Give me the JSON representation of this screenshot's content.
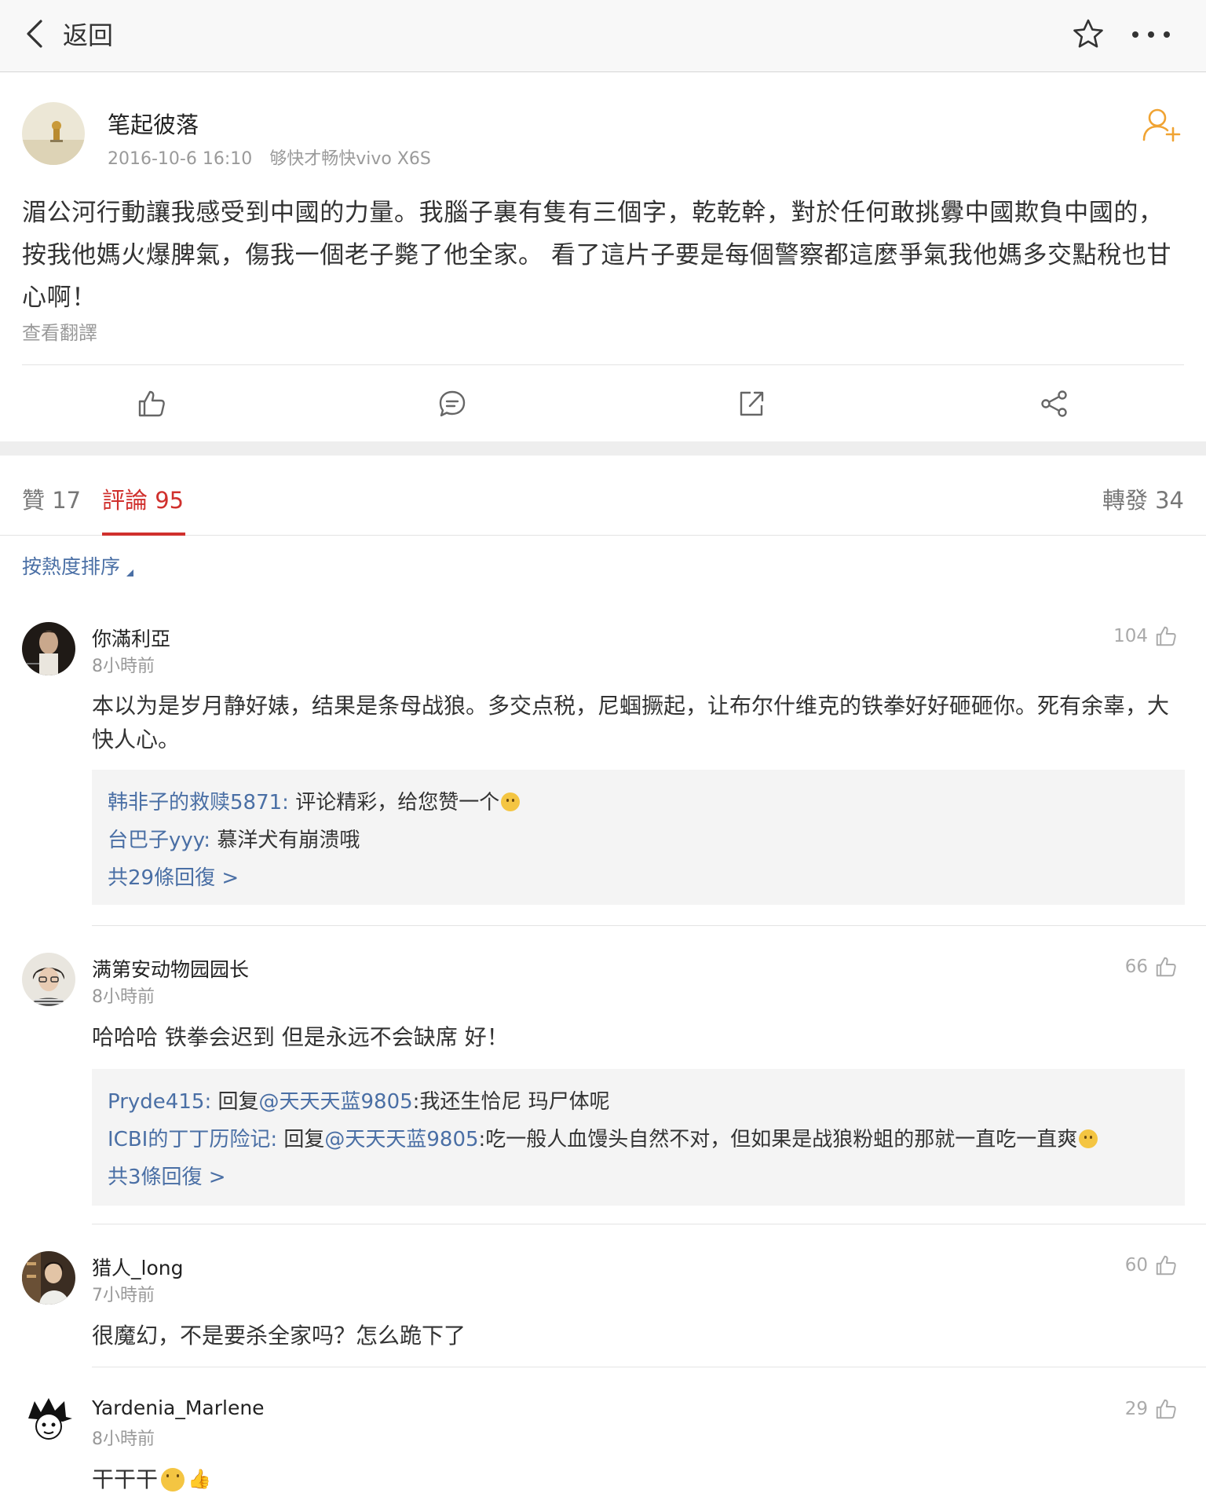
{
  "nav": {
    "back_label": "返回"
  },
  "post": {
    "author": "笔起彼落",
    "date": "2016-10-6 16:10",
    "source": "够快才畅快vivo X6S",
    "text": "湄公河行動讓我感受到中國的力量。我腦子裏有隻有三個字，乾乾幹，對於任何敢挑釁中國欺負中國的，按我他媽火爆脾氣，傷我一個老子斃了他全家。 看了這片子要是每個警察都這麼爭氣我他媽多交點稅也甘心啊！",
    "translate_label": "查看翻譯"
  },
  "tabs": {
    "likes": "贊 17",
    "comments": "評論 95",
    "reposts": "轉發 34"
  },
  "sort_label": "按熱度排序",
  "comments": [
    {
      "name": "你滿利亞",
      "time": "8小時前",
      "likes": "104",
      "text": "本以为是岁月静好婊，结果是条母战狼。多交点税，尼蝈撅起，让布尔什维克的铁拳好好砸砸你。死有余辜，大快人心。",
      "replies": [
        {
          "user": "韩非子的救赎5871",
          "sep": ": ",
          "text": "评论精彩，给您赞一个",
          "mention": "",
          "rest": ""
        },
        {
          "user": "台巴子yyy",
          "sep": ": ",
          "text": "慕洋犬有崩溃哦",
          "mention": "",
          "rest": ""
        }
      ],
      "more": "共29條回復 >"
    },
    {
      "name": "满第安动物园园长",
      "time": "8小時前",
      "likes": "66",
      "text": "哈哈哈 铁拳会迟到 但是永远不会缺席 好！",
      "replies": [
        {
          "user": "Pryde415",
          "sep": ": ",
          "text": "回复",
          "mention": "@天天天蓝9805",
          "rest": ":我还生恰尼 玛尸体呢"
        },
        {
          "user": "ICBI的丁丁历险记",
          "sep": ": ",
          "text": "回复",
          "mention": "@天天天蓝9805",
          "rest": ":吃一般人血馒头自然不对，但如果是战狼粉蛆的那就一直吃一直爽"
        }
      ],
      "more": "共3條回復 >"
    },
    {
      "name": "猎人_long",
      "time": "7小時前",
      "likes": "60",
      "text": "很魔幻，不是要杀全家吗？怎么跪下了"
    },
    {
      "name": "Yardenia_Marlene",
      "time": "8小時前",
      "likes": "29",
      "text": "干干干"
    }
  ]
}
